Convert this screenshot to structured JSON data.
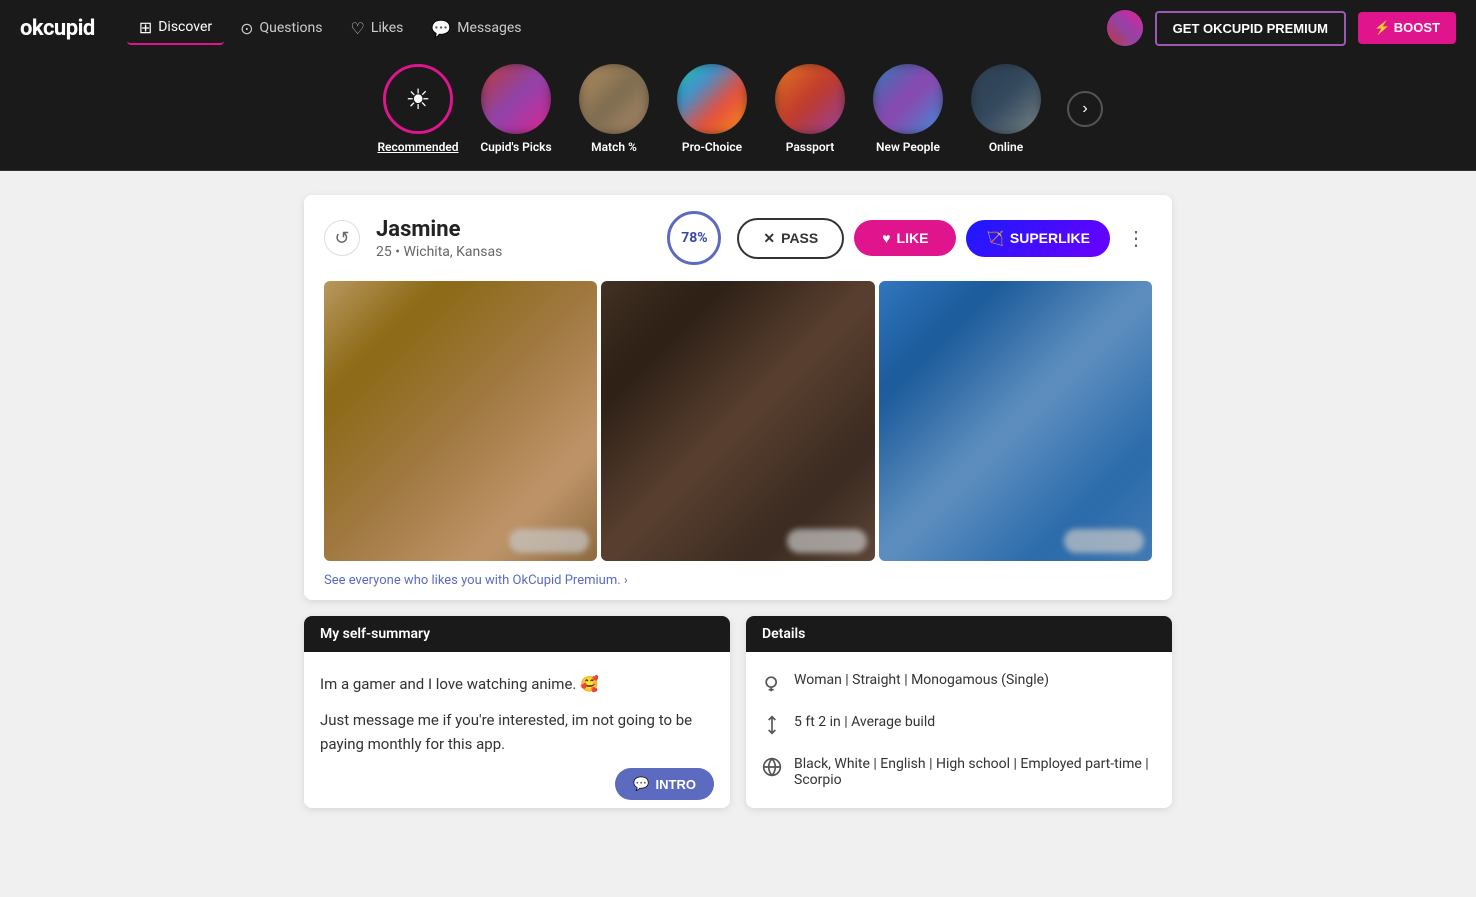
{
  "app": {
    "logo": "okcupid",
    "premium_btn": "GET OKCUPID PREMIUM",
    "boost_btn": "⚡ BOOST"
  },
  "nav": {
    "items": [
      {
        "id": "discover",
        "label": "Discover",
        "icon": "⊞",
        "active": true
      },
      {
        "id": "questions",
        "label": "Questions",
        "icon": "?"
      },
      {
        "id": "likes",
        "label": "Likes",
        "icon": "♡"
      },
      {
        "id": "messages",
        "label": "Messages",
        "icon": "💬"
      }
    ]
  },
  "categories": [
    {
      "id": "recommended",
      "label": "Recommended",
      "active": true,
      "type": "icon"
    },
    {
      "id": "cupids-picks",
      "label": "Cupid's Picks",
      "type": "photo",
      "photoClass": "pink"
    },
    {
      "id": "match",
      "label": "Match %",
      "type": "photo",
      "photoClass": "warm"
    },
    {
      "id": "pro-choice",
      "label": "Pro-Choice",
      "type": "photo",
      "photoClass": "multi"
    },
    {
      "id": "passport",
      "label": "Passport",
      "type": "photo",
      "photoClass": "orange"
    },
    {
      "id": "new-people",
      "label": "New People",
      "type": "photo",
      "photoClass": "blue"
    },
    {
      "id": "online",
      "label": "Online",
      "type": "photo",
      "photoClass": "dark"
    }
  ],
  "profile": {
    "name": "Jasmine",
    "age": "25",
    "location": "Wichita, Kansas",
    "match_pct": "78%",
    "pass_label": "PASS",
    "like_label": "LIKE",
    "superlike_label": "SUPERLIKE",
    "premium_promo": "See everyone who likes you with OkCupid Premium. ›",
    "self_summary_header": "My self-summary",
    "self_summary_line1": "Im a gamer and I love watching anime. 🥰",
    "self_summary_line2": "Just message me if you're interested, im not going to be paying monthly for this app.",
    "intro_label": "INTRO",
    "details_header": "Details",
    "details": [
      {
        "icon": "♀",
        "text": "Woman | Straight | Monogamous (Single)"
      },
      {
        "icon": "↕",
        "text": "5 ft 2 in | Average build"
      },
      {
        "icon": "🌐",
        "text": "Black, White | English | High school | Employed part-time | Scorpio"
      }
    ]
  }
}
